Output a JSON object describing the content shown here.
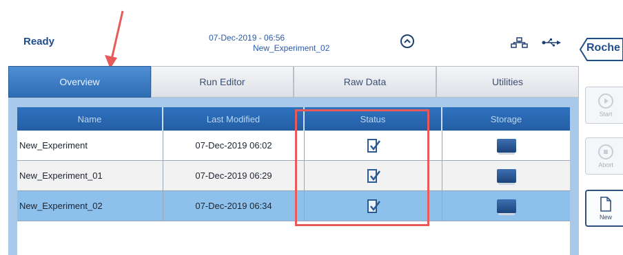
{
  "status_bar": {
    "state": "Ready",
    "datetime": "07-Dec-2019 - 06:56",
    "experiment": "New_Experiment_02"
  },
  "brand": {
    "logo_text": "Roche"
  },
  "tabs": [
    {
      "label": "Overview",
      "active": true
    },
    {
      "label": "Run Editor",
      "active": false
    },
    {
      "label": "Raw Data",
      "active": false
    },
    {
      "label": "Utilities",
      "active": false
    }
  ],
  "table": {
    "columns": [
      "Name",
      "Last Modified",
      "Status",
      "Storage"
    ],
    "rows": [
      {
        "name": "New_Experiment",
        "modified": "07-Dec-2019 06:02",
        "status_icon": "check-document-icon",
        "storage_icon": "book-icon"
      },
      {
        "name": "New_Experiment_01",
        "modified": "07-Dec-2019 06:29",
        "status_icon": "check-document-icon",
        "storage_icon": "book-icon"
      },
      {
        "name": "New_Experiment_02",
        "modified": "07-Dec-2019 06:34",
        "status_icon": "check-document-icon",
        "storage_icon": "book-icon",
        "selected": true
      }
    ]
  },
  "side_buttons": {
    "start": "Start",
    "abort": "Abort",
    "new": "New"
  },
  "colors": {
    "accent": "#2e6cb3",
    "selected_row": "#8ec0ec",
    "annotation": "#e85a5a"
  }
}
